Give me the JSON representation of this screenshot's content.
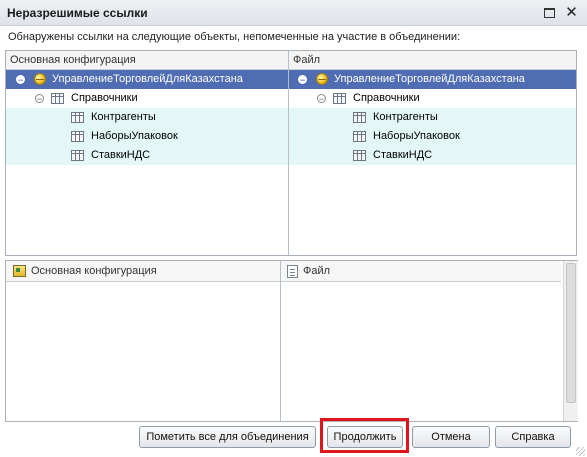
{
  "window": {
    "title": "Неразрешимые ссылки"
  },
  "info_text": "Обнаружены ссылки на следующие объекты, непомеченные на участие в объединении:",
  "top_left": {
    "header": "Основная конфигурация",
    "tree": {
      "root": "УправлениеТорговлейДляКазахстана",
      "group": "Справочники",
      "items": [
        "Контрагенты",
        "НаборыУпаковок",
        "СтавкиНДС"
      ]
    }
  },
  "top_right": {
    "header": "Файл",
    "tree": {
      "root": "УправлениеТорговлейДляКазахстана",
      "group": "Справочники",
      "items": [
        "Контрагенты",
        "НаборыУпаковок",
        "СтавкиНДС"
      ]
    }
  },
  "bottom_left": {
    "header": "Основная конфигурация"
  },
  "bottom_right": {
    "header": "Файл"
  },
  "buttons": {
    "mark_all": "Пометить все для объединения",
    "continue": "Продолжить",
    "cancel": "Отмена",
    "help": "Справка"
  },
  "colors": {
    "selection": "#506db3",
    "row_tint": "#e2f7f6",
    "highlight_border": "#e0141b"
  }
}
